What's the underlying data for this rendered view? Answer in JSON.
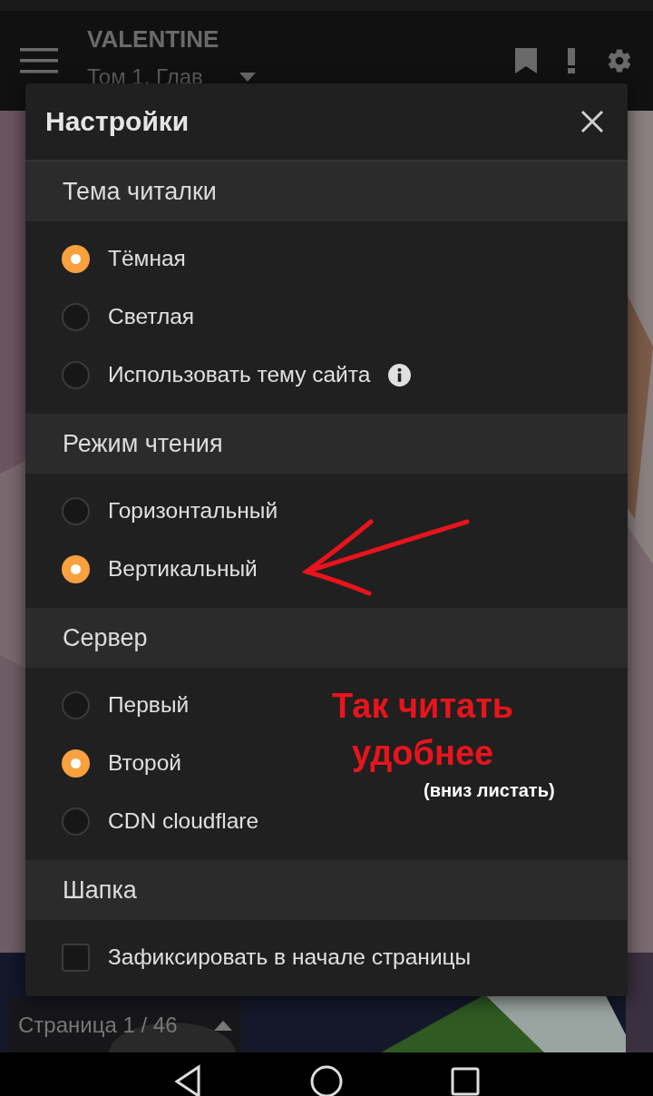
{
  "app_bar": {
    "title": "VALENTINE",
    "subtitle": "Том 1. Глав"
  },
  "dialog": {
    "title": "Настройки",
    "sections": [
      {
        "heading": "Тема читалки",
        "options": [
          {
            "kind": "radio",
            "label": "Тёмная",
            "selected": true
          },
          {
            "kind": "radio",
            "label": "Светлая",
            "selected": false
          },
          {
            "kind": "radio",
            "label": "Использовать тему сайта",
            "selected": false,
            "info": true
          }
        ]
      },
      {
        "heading": "Режим чтения",
        "options": [
          {
            "kind": "radio",
            "label": "Горизонтальный",
            "selected": false
          },
          {
            "kind": "radio",
            "label": "Вертикальный",
            "selected": true
          }
        ]
      },
      {
        "heading": "Сервер",
        "options": [
          {
            "kind": "radio",
            "label": "Первый",
            "selected": false
          },
          {
            "kind": "radio",
            "label": "Второй",
            "selected": true
          },
          {
            "kind": "radio",
            "label": "CDN cloudflare",
            "selected": false
          }
        ]
      },
      {
        "heading": "Шапка",
        "options": [
          {
            "kind": "checkbox",
            "label": "Зафиксировать в начале страницы",
            "checked": false
          }
        ]
      }
    ]
  },
  "annotation": {
    "lines": [
      "Так читать",
      "удобнее"
    ],
    "note": "(вниз листать)"
  },
  "page_indicator": {
    "label": "Страница 1 / 46"
  }
}
